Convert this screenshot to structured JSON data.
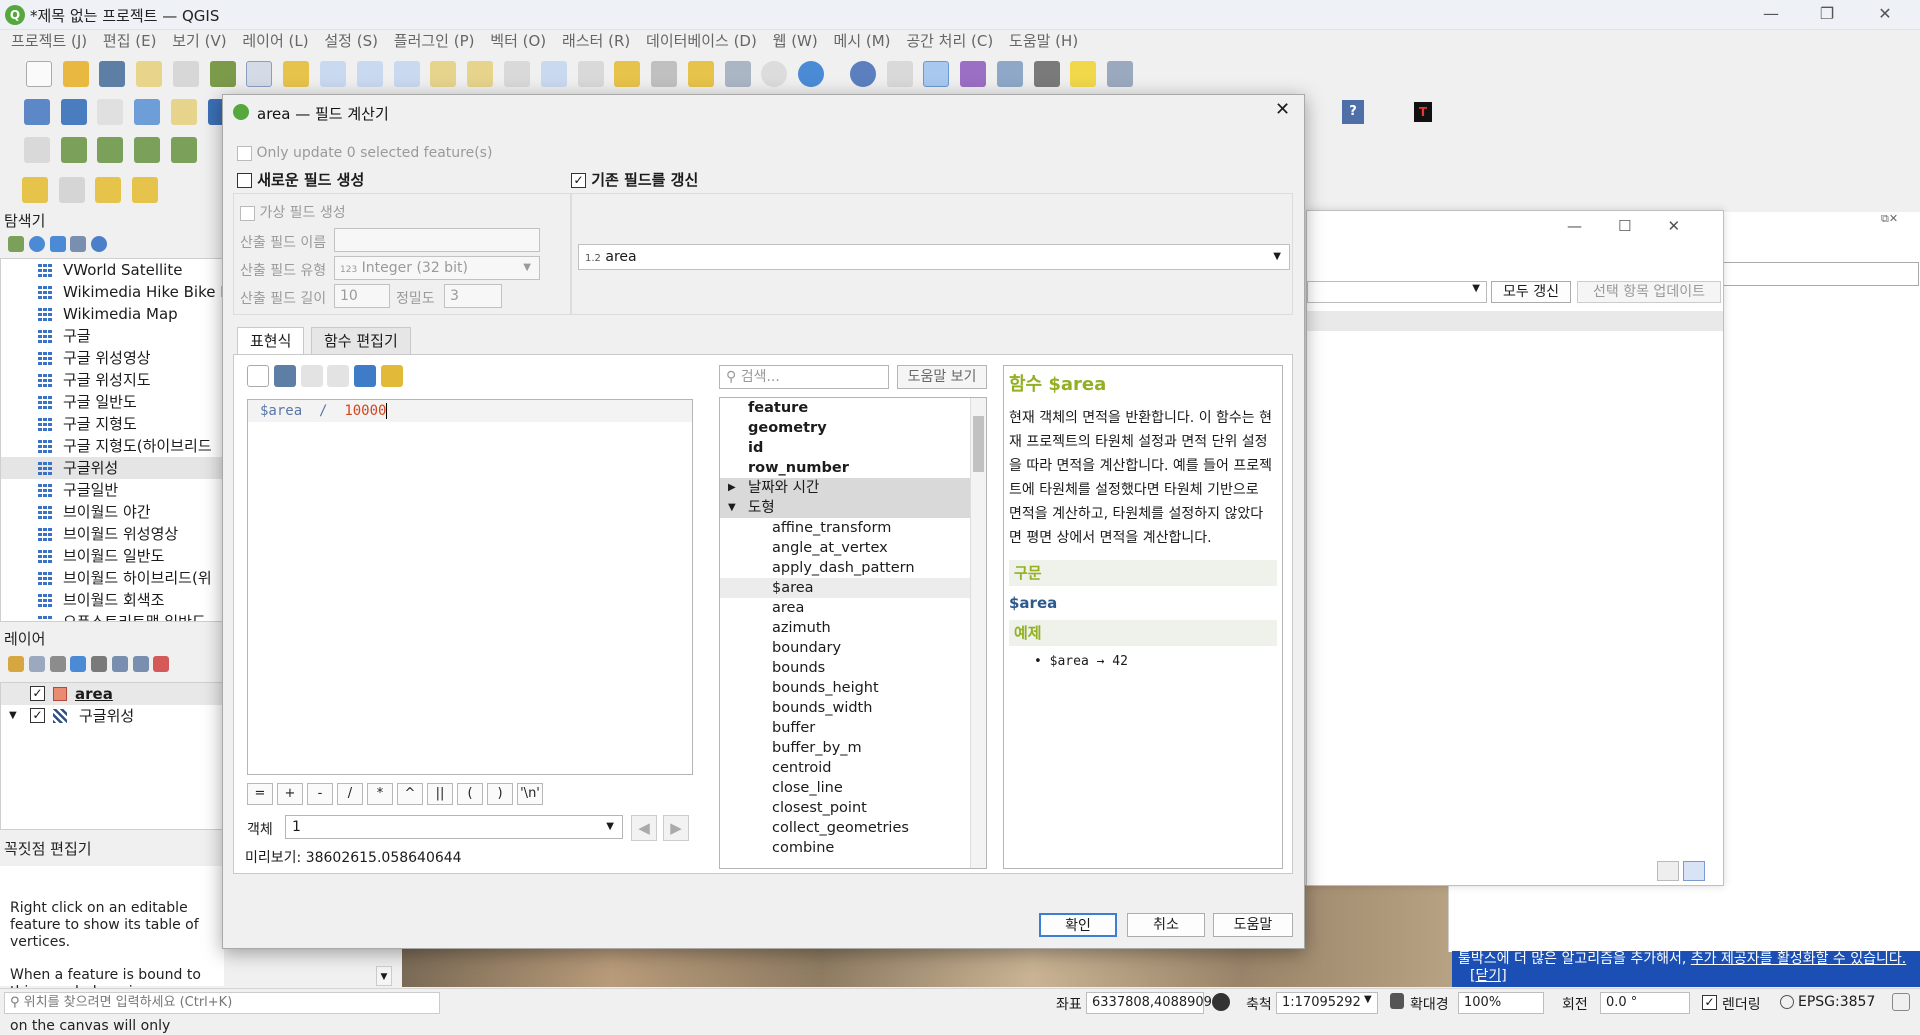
{
  "window": {
    "title": "*제목 없는 프로젝트 — QGIS",
    "logo_text": "Q"
  },
  "menubar": [
    "프로젝트 (J)",
    "편집 (E)",
    "보기 (V)",
    "레이어 (L)",
    "설정 (S)",
    "플러그인 (P)",
    "벡터 (O)",
    "래스터 (R)",
    "데이터베이스 (D)",
    "웹 (W)",
    "메시 (M)",
    "공간 처리 (C)",
    "도움말 (H)"
  ],
  "browser": {
    "title": "탐색기",
    "items": [
      "VWorld Satellite",
      "Wikimedia Hike Bike M",
      "Wikimedia Map",
      "구글",
      "구글 위성영상",
      "구글 위성지도",
      "구글 일반도",
      "구글 지형도",
      "구글 지형도(하이브리드",
      "구글위성",
      "구글일반",
      "브이월드 야간",
      "브이월드 위성영상",
      "브이월드 일반도",
      "브이월드 하이브리드(위",
      "브이월드 회색조",
      "오픈스트리트맵 일반도"
    ]
  },
  "layers": {
    "title": "레이어",
    "items": [
      {
        "name": "area",
        "checked": true
      },
      {
        "name": "구글위성",
        "checked": true
      }
    ]
  },
  "vertex_panel": {
    "title": "꼭짓점 편집기",
    "text1": "Right click on an editable feature to show its table of vertices.",
    "text2": "When a feature is bound to this panel, dragging a rectangle to select vertices on the canvas will only"
  },
  "search_bar": {
    "placeholder": "위치를 찾으려면 입력하세요 (Ctrl+K)"
  },
  "statusbar": {
    "coord_label": "좌표",
    "coord_value": "6337808,4088909",
    "scale_label": "축척",
    "scale_value": "1:17095292",
    "magnifier_label": "확대경",
    "magnifier_value": "100%",
    "rotation_label": "회전",
    "rotation_value": "0.0 °",
    "render_label": "렌더링",
    "crs": "EPSG:3857"
  },
  "bg_window": {
    "update_all": "모두 갱신",
    "update_selected": "선택 항목 업데이트"
  },
  "infobar": {
    "text": "툴박스에 더 많은 알고리즘을 추가해서, ",
    "link1": "추가 제공자를 활성화할 수 있습니다.",
    "link2": "[닫기]"
  },
  "dialog": {
    "title": "area — 필드 계산기",
    "only_update": "Only update 0 selected feature(s)",
    "new_field": "새로운 필드 생성",
    "update_existing": "기존 필드를 갱신",
    "virtual_field": "가상 필드 생성",
    "output_name_label": "산출 필드 이름",
    "output_type_label": "산출 필드 유형",
    "output_type_value": "Integer (32 bit)",
    "output_type_prefix": "123",
    "output_length_label": "산출 필드 길이",
    "output_length_value": "10",
    "precision_label": "정밀도",
    "precision_value": "3",
    "field_select_prefix": "1.2",
    "field_select_value": "area",
    "tabs": [
      "표현식",
      "함수 편집기"
    ],
    "expression_var": "$area",
    "expression_op": "/",
    "expression_num": "10000",
    "operators": [
      "=",
      "+",
      "-",
      "/",
      "*",
      "^",
      "||",
      "(",
      ")",
      "'\\n'"
    ],
    "feature_label": "객체",
    "feature_value": "1",
    "preview_label": "미리보기:",
    "preview_value": "38602615.058640644",
    "search_placeholder": "검색...",
    "help_button": "도움말 보기",
    "function_list": {
      "top_items": [
        "feature",
        "geometry",
        "id",
        "row_number"
      ],
      "groups": [
        {
          "name": "날짜와 시간",
          "expanded": false
        },
        {
          "name": "도형",
          "expanded": true
        }
      ],
      "geometry_items": [
        "affine_transform",
        "angle_at_vertex",
        "apply_dash_pattern",
        "$area",
        "area",
        "azimuth",
        "boundary",
        "bounds",
        "bounds_height",
        "bounds_width",
        "buffer",
        "buffer_by_m",
        "centroid",
        "close_line",
        "closest_point",
        "collect_geometries",
        "combine"
      ],
      "selected": "$area"
    },
    "help": {
      "title": "함수 $area",
      "description": "현재 객체의 면적을 반환합니다. 이 함수는 현재 프로젝트의 타원체 설정과 면적 단위 설정을 따라 면적을 계산합니다. 예를 들어 프로젝트에 타원체를 설정했다면 타원체 기반으로 면적을 계산하고, 타원체를 설정하지 않았다면 평면 상에서 면적을 계산합니다.",
      "syntax_header": "구문",
      "syntax": "$area",
      "example_header": "예제",
      "example": "$area → 42"
    },
    "buttons": {
      "ok": "확인",
      "cancel": "취소",
      "help": "도움말"
    }
  }
}
